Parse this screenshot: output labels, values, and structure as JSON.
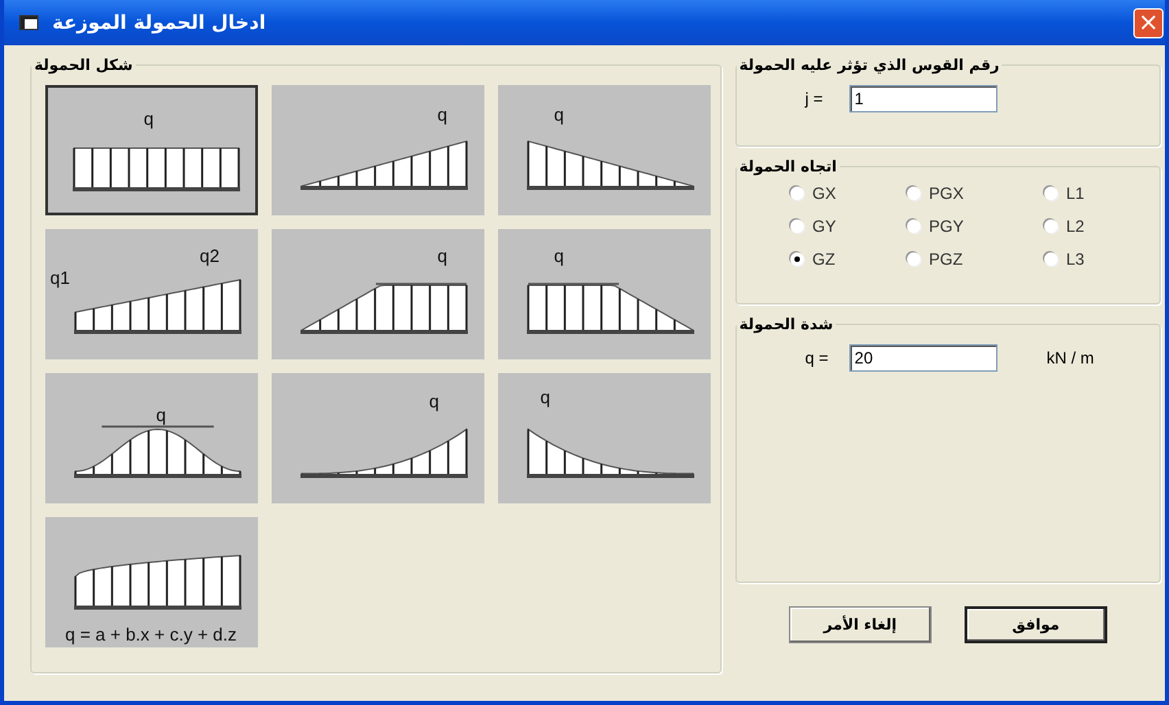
{
  "window": {
    "title": "ادخال الحمولة الموزعة",
    "close": "×"
  },
  "shape_group": {
    "title": "شكل الحمولة",
    "shapes": [
      {
        "kind": "ramp-down",
        "labels": [
          "q"
        ],
        "selected": false
      },
      {
        "kind": "ramp-up",
        "labels": [
          "q"
        ],
        "selected": false
      },
      {
        "kind": "uniform",
        "labels": [
          "q"
        ],
        "selected": true
      },
      {
        "kind": "plateau-ramp",
        "labels": [
          "q"
        ],
        "selected": false
      },
      {
        "kind": "ramp-plateau",
        "labels": [
          "q"
        ],
        "selected": false
      },
      {
        "kind": "trapezoid",
        "labels": [
          "q1",
          "q2"
        ],
        "selected": false
      },
      {
        "kind": "curve-down",
        "labels": [
          "q"
        ],
        "selected": false
      },
      {
        "kind": "curve-up",
        "labels": [
          "q"
        ],
        "selected": false
      },
      {
        "kind": "hump",
        "labels": [
          "q"
        ],
        "selected": false
      },
      {
        "kind": "polynomial",
        "labels": [
          "q = a + b.x + c.y + d.z"
        ],
        "selected": false
      }
    ]
  },
  "arc_group": {
    "title": "رقم القوس الذي تؤثر عليه الحمولة",
    "label": "j =",
    "value": "1"
  },
  "direction_group": {
    "title": "اتجاه الحمولة",
    "options": [
      {
        "label": "L1",
        "selected": false
      },
      {
        "label": "PGX",
        "selected": false
      },
      {
        "label": "GX",
        "selected": false
      },
      {
        "label": "L2",
        "selected": false
      },
      {
        "label": "PGY",
        "selected": false
      },
      {
        "label": "GY",
        "selected": false
      },
      {
        "label": "L3",
        "selected": false
      },
      {
        "label": "PGZ",
        "selected": false
      },
      {
        "label": "GZ",
        "selected": true
      }
    ]
  },
  "intensity_group": {
    "title": "شدة الحمولة",
    "label": "q =",
    "value": "20",
    "unit": "kN / m"
  },
  "buttons": [
    {
      "label": "موافق",
      "default": true
    },
    {
      "label": "إلغاء الأمر",
      "default": false
    }
  ]
}
